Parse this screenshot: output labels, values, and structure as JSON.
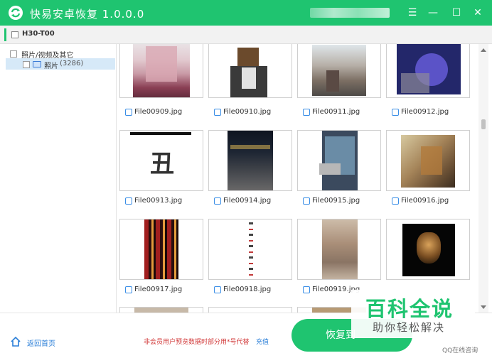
{
  "window": {
    "title": "快易安卓恢复  1.0.0.0",
    "controls": [
      "menu-icon",
      "minimize-icon",
      "maximize-icon",
      "close-icon"
    ]
  },
  "device": {
    "name": "H30-T00"
  },
  "sidebar": {
    "root_label": "照片/视频及其它",
    "child_label": "照片",
    "child_count": "(3286)"
  },
  "files": [
    {
      "name": "File00909.jpg"
    },
    {
      "name": "File00910.jpg"
    },
    {
      "name": "File00911.jpg"
    },
    {
      "name": "File00912.jpg"
    },
    {
      "name": "File00913.jpg"
    },
    {
      "name": "File00914.jpg"
    },
    {
      "name": "File00915.jpg"
    },
    {
      "name": "File00916.jpg"
    },
    {
      "name": "File00917.jpg"
    },
    {
      "name": "File00918.jpg"
    },
    {
      "name": "File00919.jpg"
    },
    {
      "name": ""
    }
  ],
  "thumb_913_char": "丑",
  "footer": {
    "home_label": "返回首页",
    "notice": "非会员用户预览数据时部分用*号代替",
    "recharge": "充值",
    "recover_label": "恢复到"
  },
  "watermark": {
    "logo": "百科全说",
    "tagline": "助你轻松解决",
    "qq": "QQ在线咨询"
  },
  "colors": {
    "accent": "#1fc470",
    "link": "#2b7fd8",
    "notice": "#d23a3a"
  }
}
